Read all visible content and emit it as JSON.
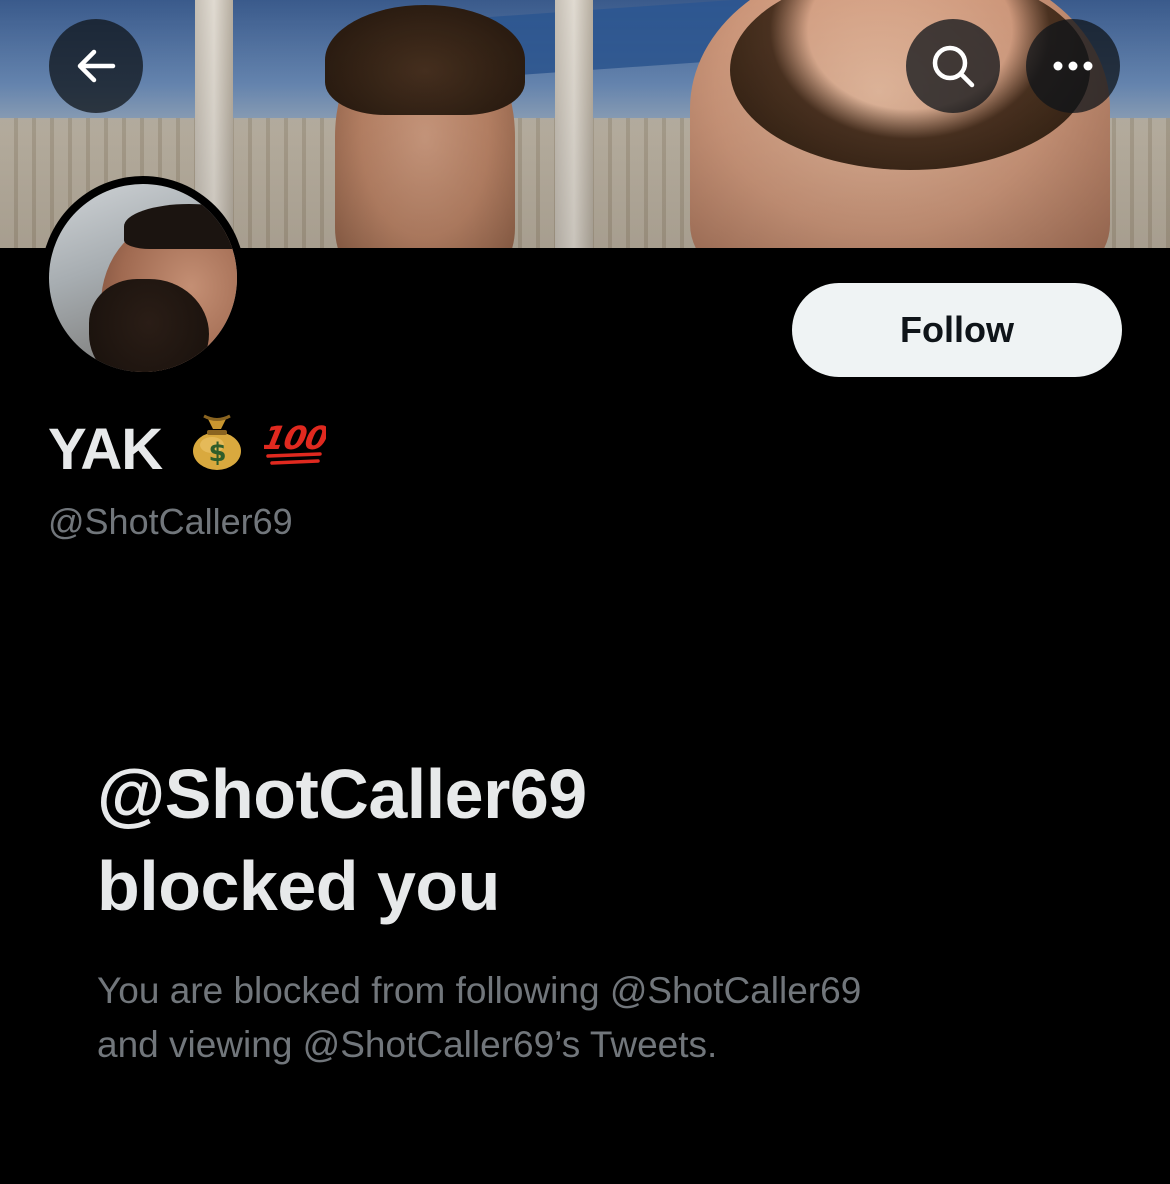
{
  "header": {
    "back_icon": "arrow-left-icon",
    "search_icon": "search-icon",
    "more_icon": "more-horizontal-icon"
  },
  "profile": {
    "display_name": "YAK",
    "name_emojis": [
      "money-bag-emoji",
      "hundred-points-emoji"
    ],
    "handle": "@ShotCaller69",
    "follow_label": "Follow"
  },
  "blocked_notice": {
    "title_line1": "@ShotCaller69",
    "title_line2": "blocked you",
    "description_line1": "You are blocked from following @ShotCaller69",
    "description_line2": "and viewing @ShotCaller69’s Tweets."
  },
  "colors": {
    "background": "#000000",
    "primary_text": "#e7e9ea",
    "secondary_text": "#71767b",
    "follow_button_bg": "#eff3f4",
    "follow_button_text": "#0f1419"
  }
}
